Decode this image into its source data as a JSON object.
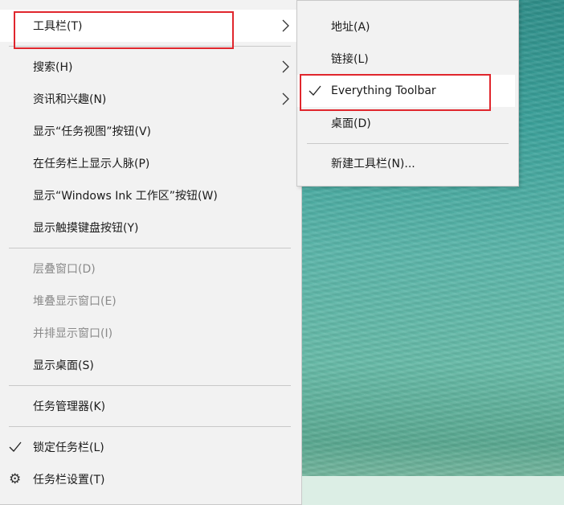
{
  "main_menu": {
    "items": [
      {
        "label": "工具栏(T)",
        "enabled": true,
        "submenu": true,
        "highlighted": true
      },
      {
        "label": "搜索(H)",
        "enabled": true,
        "submenu": true
      },
      {
        "label": "资讯和兴趣(N)",
        "enabled": true,
        "submenu": true
      },
      {
        "label": "显示“任务视图”按钮(V)",
        "enabled": true
      },
      {
        "label": "在任务栏上显示人脉(P)",
        "enabled": true
      },
      {
        "label": "显示“Windows Ink 工作区”按钮(W)",
        "enabled": true
      },
      {
        "label": "显示触摸键盘按钮(Y)",
        "enabled": true
      },
      {
        "label": "层叠窗口(D)",
        "enabled": false
      },
      {
        "label": "堆叠显示窗口(E)",
        "enabled": false
      },
      {
        "label": "并排显示窗口(I)",
        "enabled": false
      },
      {
        "label": "显示桌面(S)",
        "enabled": true
      },
      {
        "label": "任务管理器(K)",
        "enabled": true
      },
      {
        "label": "锁定任务栏(L)",
        "enabled": true,
        "checked": true
      },
      {
        "label": "任务栏设置(T)",
        "enabled": true,
        "icon": "gear-icon"
      }
    ]
  },
  "toolbar_submenu": {
    "items": [
      {
        "label": "地址(A)"
      },
      {
        "label": "链接(L)"
      },
      {
        "label": "Everything Toolbar",
        "checked": true,
        "highlighted": true
      },
      {
        "label": "桌面(D)"
      },
      {
        "label": "新建工具栏(N)..."
      }
    ]
  },
  "colors": {
    "menu_background": "#f2f2f2",
    "hover_background": "#ffffff",
    "disabled_text": "#8a8a8a",
    "annotation": "#e0262d"
  }
}
